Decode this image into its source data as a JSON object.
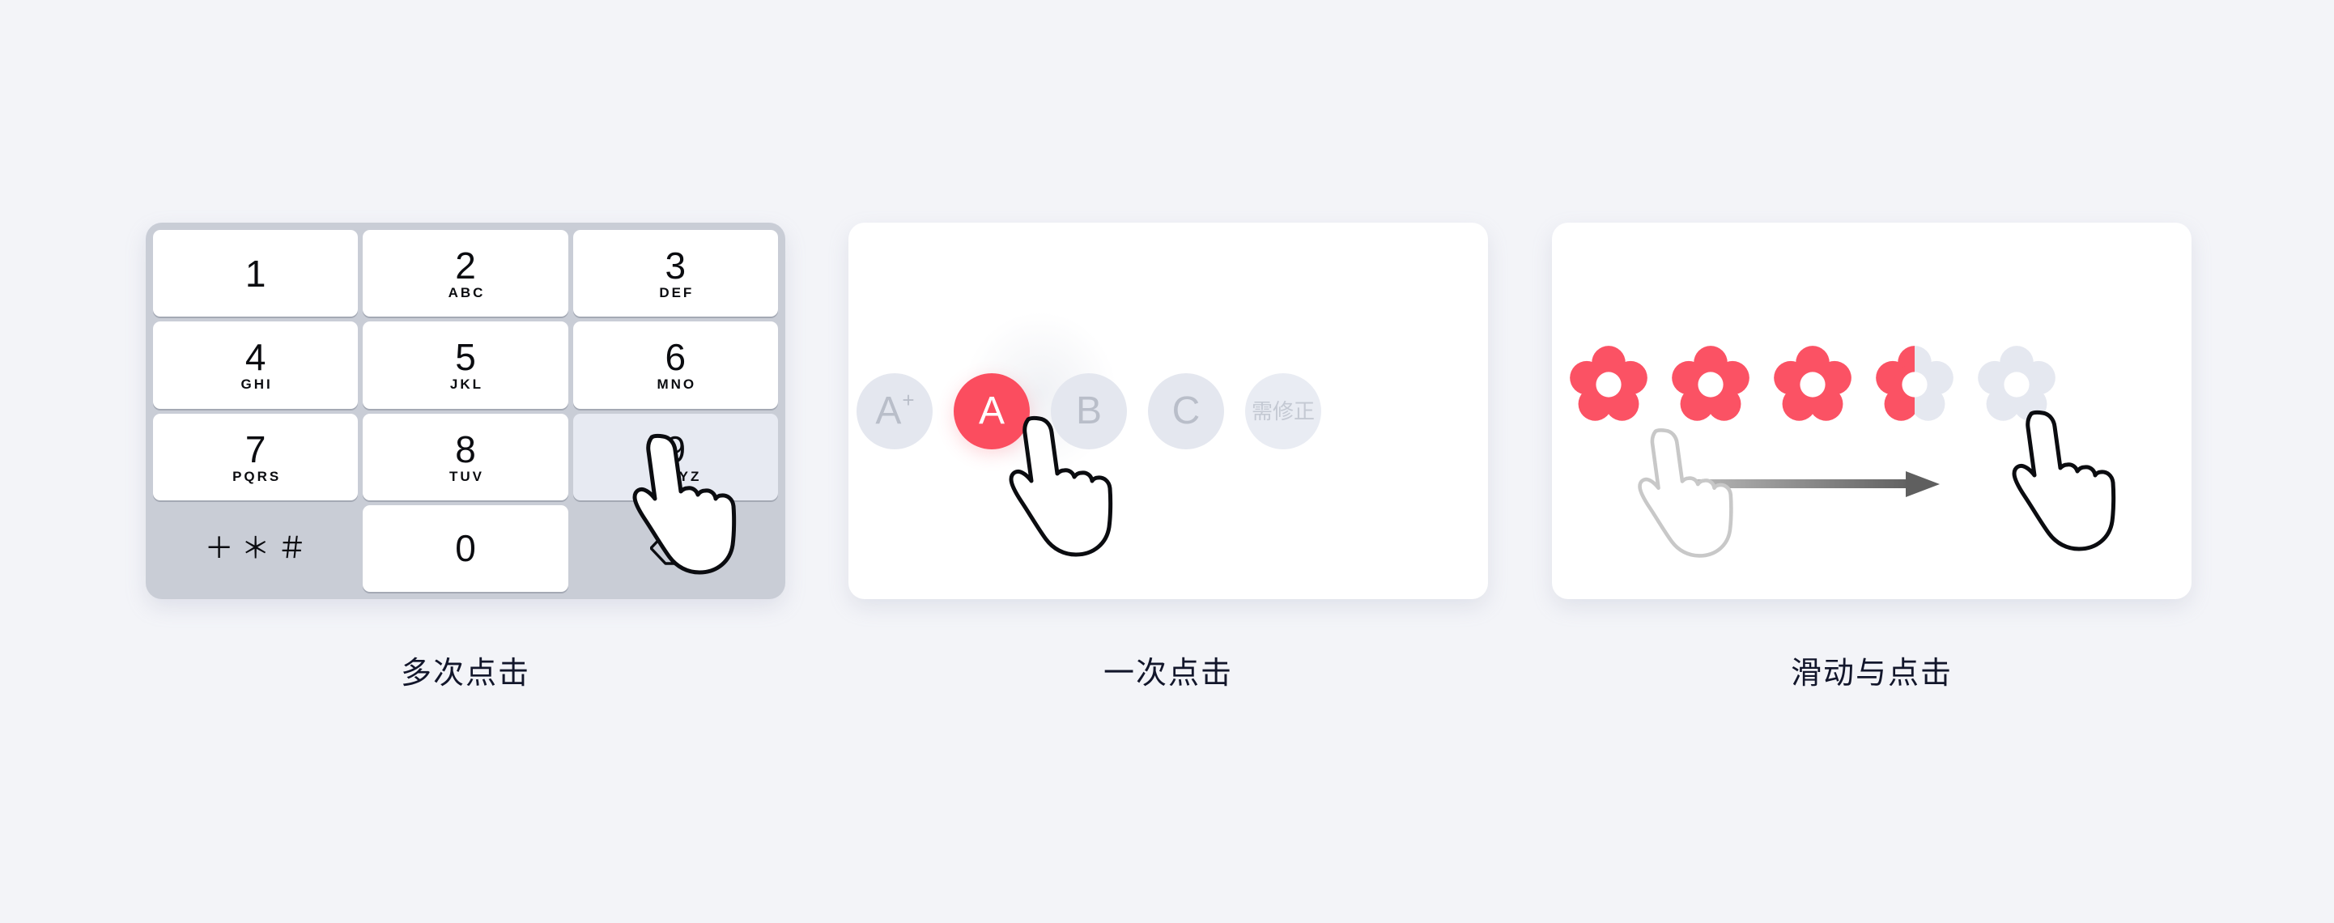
{
  "page": {
    "background_color": "#F3F4F8",
    "accent_color": "#FB4D5F",
    "muted_color": "#E4E7EF",
    "text_color": "#12162B"
  },
  "panels": [
    {
      "id": "keypad",
      "caption": "多次点击",
      "keypad": {
        "background_color": "#C9CDD6",
        "active_key_color": "#E7EAF2",
        "keys": [
          {
            "digit": "1",
            "letters": ""
          },
          {
            "digit": "2",
            "letters": "ABC"
          },
          {
            "digit": "3",
            "letters": "DEF"
          },
          {
            "digit": "4",
            "letters": "GHI"
          },
          {
            "digit": "5",
            "letters": "JKL"
          },
          {
            "digit": "6",
            "letters": "MNO"
          },
          {
            "digit": "7",
            "letters": "PQRS"
          },
          {
            "digit": "8",
            "letters": "TUV"
          },
          {
            "digit": "9",
            "letters": "WXYZ",
            "state": "active"
          },
          {
            "symbols": "＋＊＃",
            "type": "symbols"
          },
          {
            "digit": "0",
            "letters": ""
          },
          {
            "icon": "backspace-icon",
            "type": "backspace"
          }
        ]
      },
      "cursor": {
        "icon": "pointing-hand-icon",
        "target": "key-9",
        "style": "solid-black-outline"
      }
    },
    {
      "id": "single-tap",
      "caption": "一次点击",
      "grade_options": [
        {
          "label": "A",
          "superscript": "+",
          "state": "unselected"
        },
        {
          "label": "A",
          "state": "selected"
        },
        {
          "label": "B",
          "state": "unselected"
        },
        {
          "label": "C",
          "state": "unselected"
        },
        {
          "label": "需修正",
          "state": "faded",
          "type": "cjk"
        }
      ],
      "cursor": {
        "icon": "pointing-hand-icon",
        "target": "option-A",
        "style": "solid-black-outline"
      }
    },
    {
      "id": "swipe-and-tap",
      "caption": "滑动与点击",
      "rating": {
        "icon": "flower-icon",
        "max": 5,
        "value": 3.5,
        "filled_color": "#FB5264",
        "empty_color": "#E5E8F0",
        "flowers": [
          "full",
          "full",
          "full",
          "half",
          "empty"
        ]
      },
      "gesture": {
        "arrow_icon": "right-arrow-icon",
        "start_cursor": {
          "icon": "pointing-hand-icon",
          "style": "ghost-grey-outline"
        },
        "end_cursor": {
          "icon": "pointing-hand-icon",
          "style": "solid-black-outline"
        }
      }
    }
  ]
}
